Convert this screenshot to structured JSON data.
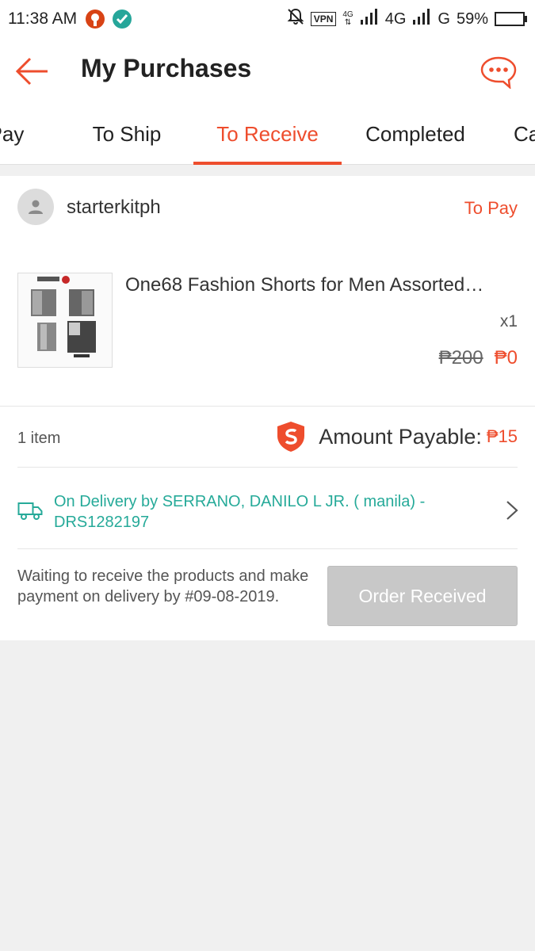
{
  "status_bar": {
    "time": "11:38 AM",
    "vpn": "VPN",
    "net_small": "4G",
    "net1": "4G",
    "net2": "G",
    "battery": "59%",
    "battery_level": 0.59
  },
  "header": {
    "title": "My Purchases"
  },
  "tabs": [
    {
      "label": "Pay"
    },
    {
      "label": "To Ship"
    },
    {
      "label": "To Receive"
    },
    {
      "label": "Completed"
    },
    {
      "label": "Ca"
    }
  ],
  "active_tab": "To Receive",
  "order": {
    "shop_name": "starterkitph",
    "status": "To Pay",
    "product_name": "One68 Fashion Shorts for Men Assorted…",
    "quantity": "x1",
    "price_original": "₱200",
    "price_final": "₱0",
    "item_count": "1 item",
    "amount_payable_label": "Amount Payable:",
    "amount_payable": "₱15",
    "delivery_info": "On Delivery by SERRANO, DANILO L JR. ( manila) - DRS1282197",
    "waiting_text": "Waiting to receive the products and make payment on delivery by #09-08-2019.",
    "order_received_label": "Order Received"
  },
  "colors": {
    "accent": "#ee4d2d",
    "delivery": "#26aa99",
    "button_disabled": "#c8c8c8"
  }
}
